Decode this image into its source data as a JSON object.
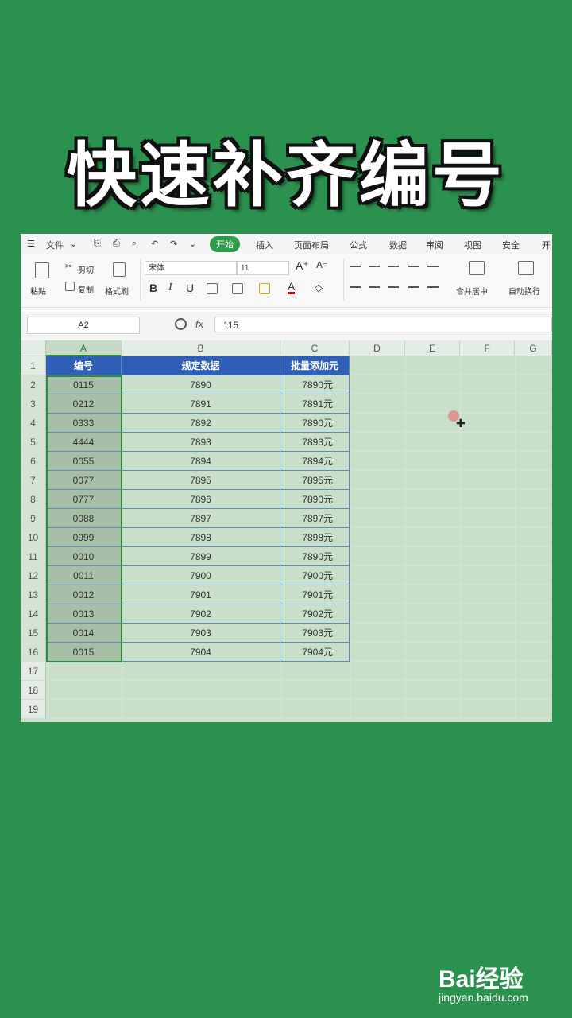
{
  "title": "快速补齐编号",
  "menu": {
    "file": "文件",
    "tabs": [
      "开始",
      "插入",
      "页面布局",
      "公式",
      "数据",
      "审阅",
      "视图",
      "安全",
      "开"
    ]
  },
  "ribbon": {
    "paste": "粘贴",
    "cut": "剪切",
    "copy": "复制",
    "format_painter": "格式刷",
    "font_name": "宋体",
    "font_size": "11",
    "bold": "B",
    "italic": "I",
    "underline": "U",
    "merge_center": "合并居中",
    "wrap_text": "自动换行"
  },
  "formula_bar": {
    "name_box": "A2",
    "fx": "fx",
    "value": "115"
  },
  "sheet": {
    "columns": [
      "A",
      "B",
      "C",
      "D",
      "E",
      "F",
      "G"
    ],
    "row_numbers": [
      "1",
      "2",
      "3",
      "4",
      "5",
      "6",
      "7",
      "8",
      "9",
      "10",
      "11",
      "12",
      "13",
      "14",
      "15",
      "16",
      "17",
      "18",
      "19"
    ],
    "headers": [
      "编号",
      "规定数据",
      "批量添加元"
    ],
    "rows": [
      [
        "0115",
        "7890",
        "7890元"
      ],
      [
        "0212",
        "7891",
        "7891元"
      ],
      [
        "0333",
        "7892",
        "7890元"
      ],
      [
        "4444",
        "7893",
        "7893元"
      ],
      [
        "0055",
        "7894",
        "7894元"
      ],
      [
        "0077",
        "7895",
        "7895元"
      ],
      [
        "0777",
        "7896",
        "7890元"
      ],
      [
        "0088",
        "7897",
        "7897元"
      ],
      [
        "0999",
        "7898",
        "7898元"
      ],
      [
        "0010",
        "7899",
        "7890元"
      ],
      [
        "0011",
        "7900",
        "7900元"
      ],
      [
        "0012",
        "7901",
        "7901元"
      ],
      [
        "0013",
        "7902",
        "7902元"
      ],
      [
        "0014",
        "7903",
        "7903元"
      ],
      [
        "0015",
        "7904",
        "7904元"
      ]
    ]
  },
  "watermark": {
    "logo": "Bai经验",
    "url": "jingyan.baidu.com"
  }
}
